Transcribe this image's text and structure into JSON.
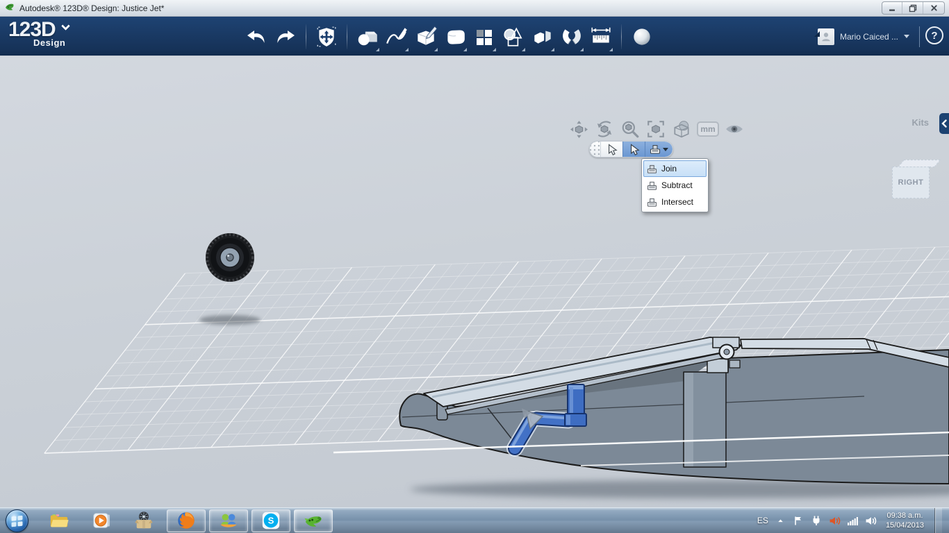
{
  "window": {
    "title": "Autodesk® 123D® Design: Justice Jet*"
  },
  "appbar": {
    "logo": {
      "primary": "123D",
      "secondary": "Design"
    },
    "tools": [
      {
        "name": "undo"
      },
      {
        "name": "redo"
      },
      {
        "name": "transform-move"
      },
      {
        "name": "primitives"
      },
      {
        "name": "sketch"
      },
      {
        "name": "modify"
      },
      {
        "name": "smooth"
      },
      {
        "name": "pattern"
      },
      {
        "name": "combine"
      },
      {
        "name": "split"
      },
      {
        "name": "snap"
      },
      {
        "name": "measure"
      },
      {
        "name": "material"
      }
    ],
    "account": {
      "name": "Mario Caiced ..."
    },
    "help_glyph": "?"
  },
  "view_toolbar": {
    "items": [
      "pan",
      "orbit",
      "zoom",
      "fit-view",
      "shading",
      "units",
      "visibility"
    ],
    "units_label": "mm"
  },
  "context_toolbar": {
    "buttons": [
      "drag-grip",
      "select-cursor",
      "select-cursor-active",
      "combine-operation-dropdown"
    ]
  },
  "combine_menu": {
    "items": [
      {
        "label": "Join",
        "selected": true
      },
      {
        "label": "Subtract",
        "selected": false
      },
      {
        "label": "Intersect",
        "selected": false
      }
    ]
  },
  "right_panel": {
    "kits_label": "Kits"
  },
  "viewcube": {
    "face_label": "RIGHT"
  },
  "taskbar": {
    "skype_letter": "S",
    "apps": [
      {
        "name": "start"
      },
      {
        "name": "windows-explorer",
        "running": false
      },
      {
        "name": "media-player",
        "running": false
      },
      {
        "name": "supply-box-app",
        "running": false
      },
      {
        "name": "firefox",
        "running": true
      },
      {
        "name": "messenger",
        "running": true
      },
      {
        "name": "skype",
        "running": true
      },
      {
        "name": "123d-design",
        "running": true,
        "active": true
      }
    ],
    "tray": {
      "language": "ES",
      "time": "09:38 a.m.",
      "date": "15/04/2013",
      "icons": [
        "hidden-icons",
        "action-center-flag",
        "power-plug",
        "volume-mixer",
        "network-signal",
        "speaker"
      ]
    }
  },
  "icons": {
    "app-icon": "green-jet-logo",
    "undo": "curved-arrow-left",
    "redo": "curved-arrow-right",
    "transform-move": "shield-with-cross-arrows",
    "primitives": "sphere-and-cube",
    "sketch": "spline-with-pen",
    "modify": "cube-with-pencil",
    "smooth": "rounded-cube",
    "pattern": "four-squares-grid",
    "combine": "circle-triangle-square",
    "split": "cut-cube",
    "snap": "magnet",
    "measure": "ruler-with-arrows",
    "material": "shaded-sphere",
    "pan": "four-way-arrows-cube",
    "orbit": "circular-arrows-cube",
    "zoom": "magnifier-cube",
    "fit-view": "corner-brackets-cube",
    "shading": "sphere-in-box",
    "visibility": "eye",
    "select-cursor": "arrow-pointer",
    "combine-operation": "press-stamp",
    "minimize": "dash",
    "restore": "overlapping-squares",
    "close": "x-cross",
    "hidden-icons": "chevron-up",
    "action-center-flag": "flag",
    "power-plug": "plug",
    "volume-mixer": "red-speaker-waves",
    "network-signal": "ascending-bars",
    "speaker": "speaker-waves"
  },
  "colors": {
    "appbar_navy": "#17375F",
    "selection_blue": "#3E6DC2",
    "menu_highlight": "#CDE3F8",
    "canvas_gray": "#CBD1D8",
    "model_gray": "#7C8997"
  }
}
